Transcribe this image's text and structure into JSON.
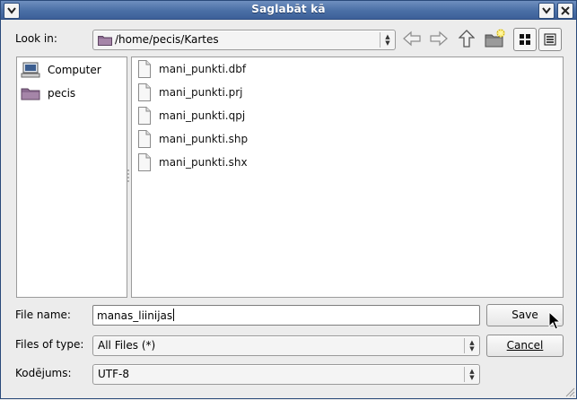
{
  "window": {
    "title": "Saglabāt kā"
  },
  "look_in": {
    "label": "Look in:",
    "path": "/home/pecis/Kartes"
  },
  "places": [
    {
      "label": "Computer",
      "icon": "computer-icon"
    },
    {
      "label": "pecis",
      "icon": "folder-icon"
    }
  ],
  "files": [
    {
      "name": "mani_punkti.dbf"
    },
    {
      "name": "mani_punkti.prj"
    },
    {
      "name": "mani_punkti.qpj"
    },
    {
      "name": "mani_punkti.shp"
    },
    {
      "name": "mani_punkti.shx"
    }
  ],
  "file_name": {
    "label": "File name:",
    "value": "manas_liinijas"
  },
  "file_type": {
    "label": "Files of type:",
    "value": "All Files (*)"
  },
  "encoding": {
    "label": "Kodējums:",
    "value": "UTF-8"
  },
  "buttons": {
    "save": "Save",
    "cancel": "Cancel"
  },
  "colors": {
    "title_bar": "#4a6fa5",
    "folder": "#8a6a8f"
  }
}
